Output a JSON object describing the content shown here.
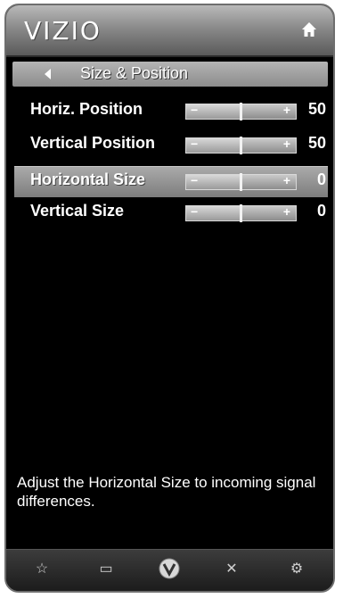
{
  "header": {
    "logo_text": "VIZIO",
    "home_icon": "home-icon"
  },
  "breadcrumb": {
    "title": "Size & Position",
    "back_icon": "back-arrow-icon"
  },
  "settings": [
    {
      "label": "Horiz. Position",
      "value": "50",
      "level": 0.5,
      "selected": false
    },
    {
      "label": "Vertical Position",
      "value": "50",
      "level": 0.5,
      "selected": false
    },
    {
      "label": "Horizontal Size",
      "value": "0",
      "level": 0.5,
      "selected": true
    },
    {
      "label": "Vertical Size",
      "value": "0",
      "level": 0.5,
      "selected": false
    }
  ],
  "slider_symbols": {
    "minus": "−",
    "plus": "+"
  },
  "description": "Adjust the Horizontal Size to incoming signal differences.",
  "footer": [
    {
      "name": "favorite-star-icon",
      "glyph": "☆"
    },
    {
      "name": "input-screen-icon",
      "glyph": "▭"
    },
    {
      "name": "vizio-v-icon",
      "glyph": "V"
    },
    {
      "name": "close-x-icon",
      "glyph": "✕"
    },
    {
      "name": "settings-gear-icon",
      "glyph": "⚙"
    }
  ]
}
